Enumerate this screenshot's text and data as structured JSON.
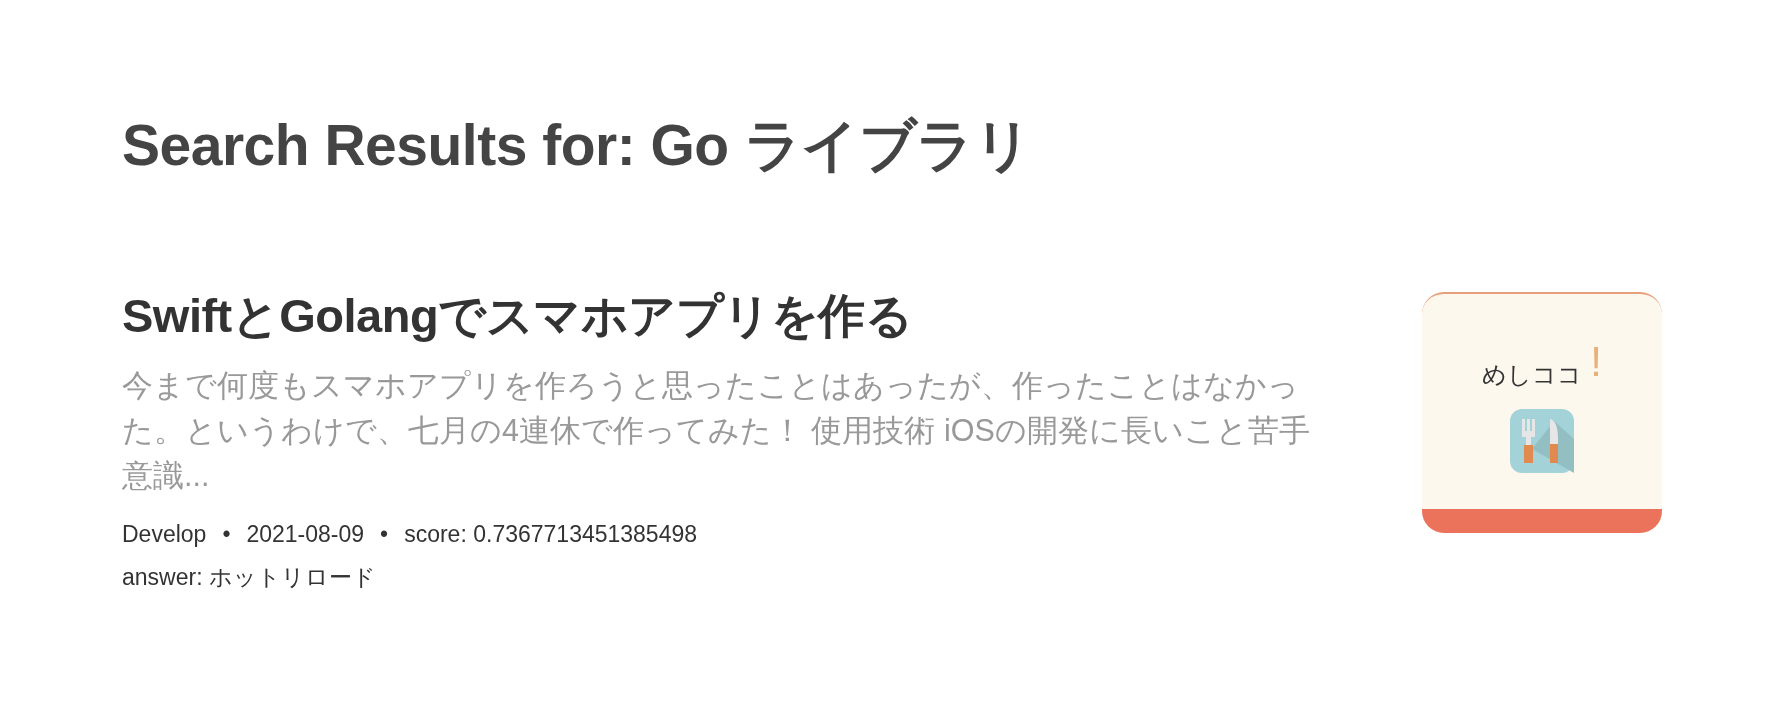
{
  "heading": "Search Results for: Go ライブラリ",
  "results": [
    {
      "title": "SwiftとGolangでスマホアプリを作る",
      "excerpt": "今まで何度もスマホアプリを作ろうと思ったことはあったが、作ったことはなかった。というわけで、七月の4連休で作ってみた！ 使用技術 iOSの開発に長いこと苦手意識...",
      "category": "Develop",
      "date": "2021-08-09",
      "score": "score: 0.7367713451385498",
      "answer": "answer: ホットリロード",
      "separator": "•",
      "thumbnail": {
        "name": "めしココ",
        "mark": "!"
      }
    }
  ]
}
